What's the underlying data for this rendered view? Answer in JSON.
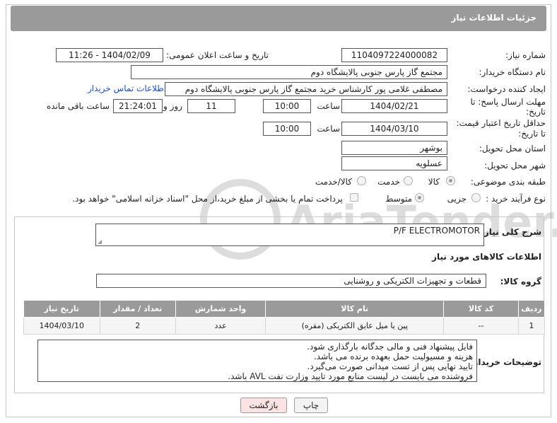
{
  "header": {
    "title": "جزئیات اطلاعات نیاز"
  },
  "fields": {
    "need_number_label": "شماره نیاز:",
    "need_number": "1104097224000082",
    "announce_label": "تاریخ و ساعت اعلان عمومی:",
    "announce_value": "1404/02/09 - 11:26",
    "buyer_org_label": "نام دستگاه خریدار:",
    "buyer_org": "مجتمع گاز پارس جنوبی  پالایشگاه دوم",
    "creator_label": "ایجاد کننده درخواست:",
    "creator": "مصطفی غلامی پور کارشناس خرید مجتمع گاز پارس جنوبی  پالایشگاه دوم",
    "buyer_contact_link": "اطلاعات تماس خریدار",
    "deadline_label_1": "مهلت ارسال پاسخ: تا",
    "deadline_label_2": "تاریخ:",
    "deadline_date": "1404/02/21",
    "time_label": "ساعت",
    "deadline_time": "10:00",
    "days_value": "11",
    "days_label": "روز و",
    "remaining_value": "21:24:01",
    "remaining_label": "ساعت باقی مانده",
    "price_label_1": "حداقل تاریخ اعتبار قیمت:",
    "price_label_2": "تا تاریخ:",
    "price_date": "1404/03/10",
    "price_time": "10:00",
    "province_label": "استان محل تحویل:",
    "province": "بوشهر",
    "city_label": "شهر محل تحویل:",
    "city": "عسلویه",
    "category_label": "طبقه بندی موضوعی:",
    "category_options": [
      "کالا",
      "خدمت",
      "کالا/خدمت"
    ],
    "process_label": "نوع فرآیند خرید :",
    "process_options": [
      "جزیی",
      "متوسط"
    ],
    "payment_note": "پرداخت تمام یا بخشی از مبلغ خرید،از محل \"اسناد خزانه اسلامی\" خواهد بود."
  },
  "description": {
    "label": "شرح کلی نیاز:",
    "value": "P/F ELECTROMOTOR"
  },
  "goods": {
    "section_title": "اطلاعات کالاهای مورد نیاز",
    "group_label": "گروه کالا:",
    "group_value": "قطعات و تجهیزات الکتریکی و روشنایی",
    "table": {
      "headers": [
        "ردیف",
        "کد کالا",
        "نام کالا",
        "واحد شمارش",
        "تعداد / مقدار",
        "تاریخ نیاز"
      ],
      "rows": [
        [
          "1",
          "--",
          "پین یا میل عایق الکتریکی (مقره)",
          "عدد",
          "2",
          "1404/03/10"
        ]
      ]
    }
  },
  "buyer_notes": {
    "label": "توضیحات خریدار:",
    "lines": [
      "فایل پیشنهاد فنی و مالی جدگانه بارگذاری شود.",
      "هزینه و مسیولیت حمل بعهده برنده می باشد.",
      "تایید نهایی پس از تست میدانی صورت می‌گیرد.",
      "فروشنده می بایست در لیست منابع مورد تایید وزارت نفت AVL باشد."
    ]
  },
  "buttons": {
    "print": "چاپ",
    "back": "بازگشت"
  },
  "watermark": "AriaTender.neT",
  "colors": {
    "header_bg": "#9a9a9a",
    "link": "#1a4fd0",
    "back_button": "#fbe3e3"
  }
}
